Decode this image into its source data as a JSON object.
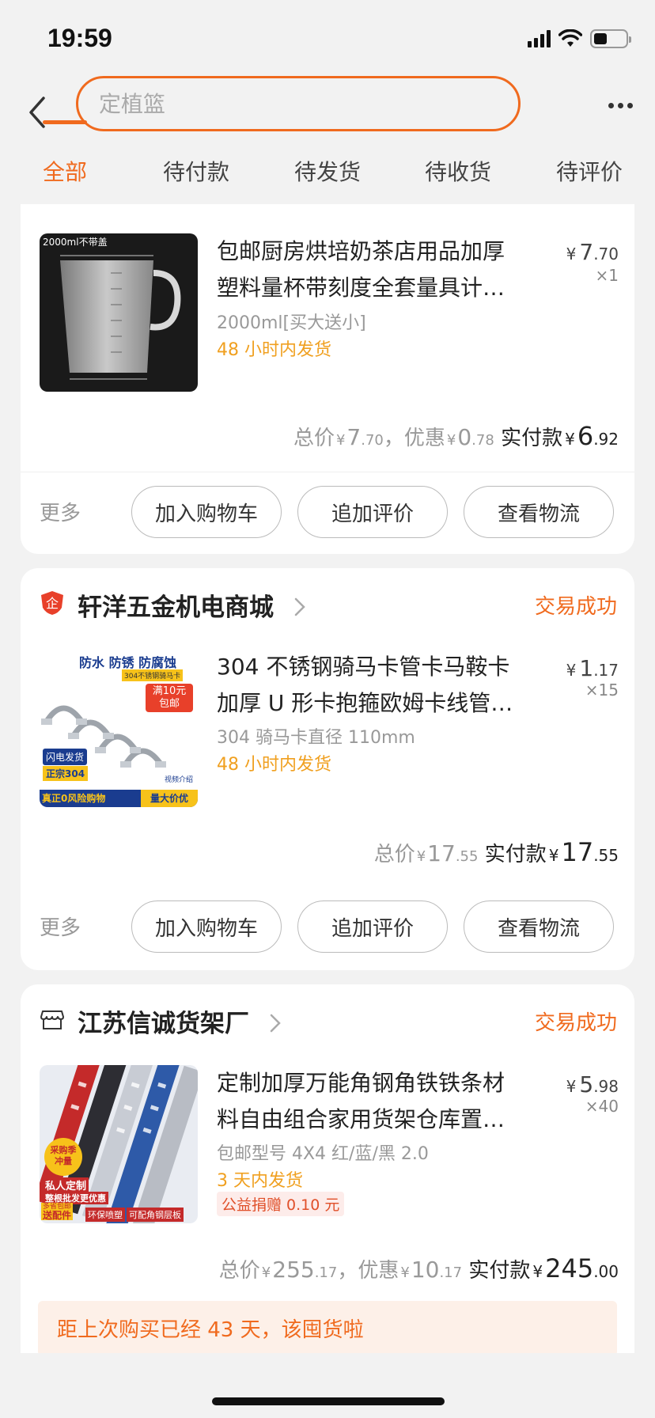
{
  "status_bar": {
    "time": "19:59"
  },
  "search": {
    "placeholder": "定植篮"
  },
  "tabs": [
    {
      "label": "全部",
      "active": true
    },
    {
      "label": "待付款"
    },
    {
      "label": "待发货"
    },
    {
      "label": "待收货"
    },
    {
      "label": "待评价"
    }
  ],
  "orders": [
    {
      "image_caption": "2000ml不带盖",
      "title_line1": "包邮厨房烘培奶茶店用品加厚",
      "title_line2": "塑料量杯带刻度全套量具计…",
      "price_currency": "¥",
      "price_int": "7",
      "price_dec": ".70",
      "quantity": "×1",
      "sku": "2000ml[买大送小]",
      "shipping": "48 小时内发货",
      "total_label": "总价",
      "total_int": "7",
      "total_dec": ".70",
      "discount_label": "，优惠",
      "discount_int": "0",
      "discount_dec": ".78",
      "paid_label": "实付款",
      "paid_int": "6",
      "paid_dec": ".92",
      "more_label": "更多",
      "buttons": [
        "加入购物车",
        "追加评价",
        "查看物流"
      ]
    },
    {
      "shop_name": "轩洋五金机电商城",
      "status": "交易成功",
      "image_text": {
        "top": "防水 防锈 防腐蚀",
        "tag": "304不锈钢骑马卡",
        "promo1": "满10元",
        "promo2": "包邮",
        "badge1": "闪电发货",
        "badge2": "正宗304",
        "video": "视频介绍",
        "bottom_left": "真正0风险购物",
        "bottom_right": "量大价优"
      },
      "title_line1": "304 不锈钢骑马卡管卡马鞍卡",
      "title_line2": "加厚 U 形卡抱箍欧姆卡线管…",
      "price_currency": "¥",
      "price_int": "1",
      "price_dec": ".17",
      "quantity": "×15",
      "sku": "304 骑马卡直径 110mm",
      "shipping": "48 小时内发货",
      "total_label": "总价",
      "total_int": "17",
      "total_dec": ".55",
      "paid_label": "实付款",
      "paid_int": "17",
      "paid_dec": ".55",
      "more_label": "更多",
      "buttons": [
        "加入购物车",
        "追加评价",
        "查看物流"
      ]
    },
    {
      "shop_name": "江苏信诚货架厂",
      "status": "交易成功",
      "image_text": {
        "badge1": "采购季",
        "badge1b": "冲量",
        "tag1": "私人定制",
        "tag2": "整根批发更优惠",
        "tag3a": "多省包邮",
        "tag3b": "送配件",
        "tag4": "环保喷塑",
        "tag5": "可配角钢层板"
      },
      "title_line1": "定制加厚万能角钢角铁铁条材",
      "title_line2": "料自由组合家用货架仓库置…",
      "price_currency": "¥",
      "price_int": "5",
      "price_dec": ".98",
      "quantity": "×40",
      "sku": "包邮型号 4X4 红/蓝/黑 2.0",
      "shipping": "3 天内发货",
      "charity": "公益捐赠 0.10 元",
      "total_label": "总价",
      "total_int": "255",
      "total_dec": ".17",
      "discount_label": "，优惠",
      "discount_int": "10",
      "discount_dec": ".17",
      "paid_label": "实付款",
      "paid_int": "245",
      "paid_dec": ".00",
      "reminder": "距上次购买已经 43 天，该囤货啦"
    }
  ],
  "colors": {
    "accent": "#f06a1e",
    "ship": "#f0a020",
    "background": "#f2f2f2"
  }
}
